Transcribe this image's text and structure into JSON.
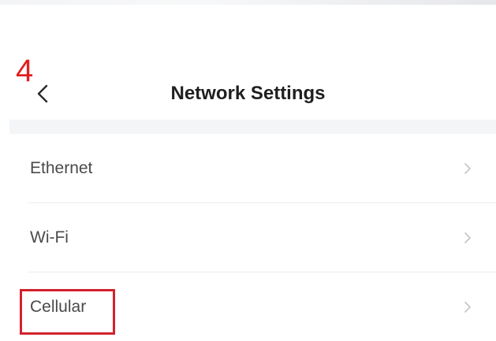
{
  "annotation": {
    "step_number": "4"
  },
  "header": {
    "title": "Network Settings",
    "back_icon": "chevron-left-icon"
  },
  "list": {
    "items": [
      {
        "label": "Ethernet",
        "icon": "chevron-right-icon"
      },
      {
        "label": "Wi-Fi",
        "icon": "chevron-right-icon"
      },
      {
        "label": "Cellular",
        "icon": "chevron-right-icon"
      }
    ]
  },
  "colors": {
    "annotation_red": "#e02020",
    "highlight_red": "#d2222d",
    "title_text": "#1f1f1f",
    "item_text": "#4a4a4a",
    "chevron": "#bdbdbd",
    "section_bg": "#f4f5f7"
  }
}
